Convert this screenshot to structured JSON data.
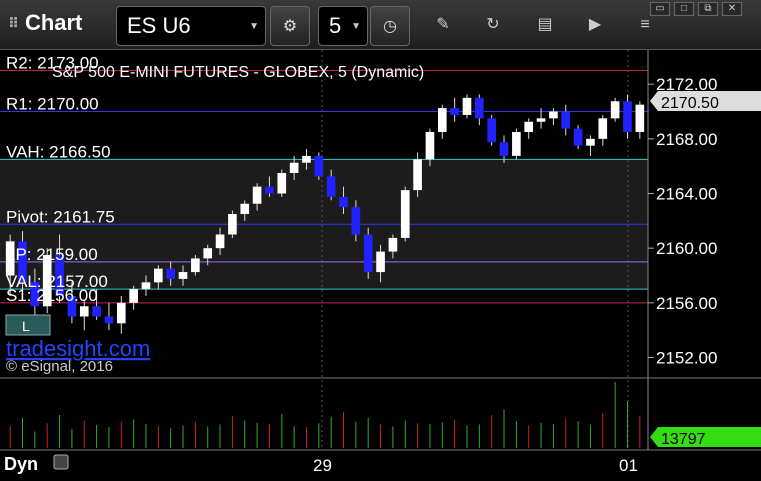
{
  "toolbar": {
    "title": "Chart",
    "symbol": "ES U6",
    "interval": "5"
  },
  "window": {
    "restore": "▭",
    "maximize": "□",
    "close": "✕"
  },
  "chart": {
    "title": "S&P 500 E-MINI FUTURES - GLOBEX, 5 (Dynamic)",
    "watermark": "tradesight.com",
    "copyright": "© eSignal, 2016",
    "price_label": "2170.50",
    "volume_label": "13797",
    "mode_label": "Dyn",
    "y_ticks": [
      "2172.00",
      "2168.00",
      "2164.00",
      "2160.00",
      "2156.00",
      "2152.00"
    ],
    "x_ticks": [
      "29",
      "01"
    ],
    "levels": [
      {
        "name": "R2",
        "label": "R2: 2173.00",
        "value": 2173.0,
        "color": "#cc2222"
      },
      {
        "name": "R1",
        "label": "R1: 2170.00",
        "value": 2170.0,
        "color": "#3333ff"
      },
      {
        "name": "VAH",
        "label": "VAH: 2166.50",
        "value": 2166.5,
        "color": "#33cccc"
      },
      {
        "name": "Pivot",
        "label": "Pivot: 2161.75",
        "value": 2161.75,
        "color": "#3333ff"
      },
      {
        "name": "LP",
        "label": "LP: 2159.00",
        "value": 2159.0,
        "color": "#aa66ff"
      },
      {
        "name": "VAL",
        "label": "VAL: 2157.00",
        "value": 2157.0,
        "color": "#33cccc"
      },
      {
        "name": "S1",
        "label": "S1: 2156.00",
        "value": 2156.0,
        "color": "#cc2255"
      }
    ],
    "badge": "L"
  },
  "chart_data": {
    "type": "bar",
    "title": "S&P 500 E-MINI FUTURES - GLOBEX, 5 (Dynamic)",
    "ylim": [
      2150.5,
      2174.5
    ],
    "candles": [
      [
        2158.0,
        2161.0,
        2156.5,
        2160.5
      ],
      [
        2160.5,
        2161.25,
        2157.0,
        2157.5
      ],
      [
        2157.5,
        2158.5,
        2155.0,
        2155.75
      ],
      [
        2155.75,
        2160.0,
        2155.25,
        2159.5
      ],
      [
        2159.5,
        2161.0,
        2156.0,
        2156.5
      ],
      [
        2156.5,
        2157.5,
        2154.5,
        2155.0
      ],
      [
        2155.0,
        2156.25,
        2154.0,
        2155.75
      ],
      [
        2155.75,
        2157.0,
        2154.75,
        2155.0
      ],
      [
        2155.0,
        2156.0,
        2154.0,
        2154.5
      ],
      [
        2154.5,
        2156.5,
        2153.75,
        2156.0
      ],
      [
        2156.0,
        2157.25,
        2155.5,
        2157.0
      ],
      [
        2157.0,
        2158.0,
        2156.5,
        2157.5
      ],
      [
        2157.5,
        2158.75,
        2157.0,
        2158.5
      ],
      [
        2158.5,
        2159.0,
        2157.25,
        2157.75
      ],
      [
        2157.75,
        2158.75,
        2157.25,
        2158.25
      ],
      [
        2158.25,
        2159.5,
        2158.0,
        2159.25
      ],
      [
        2159.25,
        2160.25,
        2158.75,
        2160.0
      ],
      [
        2160.0,
        2161.5,
        2159.5,
        2161.0
      ],
      [
        2161.0,
        2162.75,
        2160.75,
        2162.5
      ],
      [
        2162.5,
        2163.5,
        2162.0,
        2163.25
      ],
      [
        2163.25,
        2164.75,
        2162.75,
        2164.5
      ],
      [
        2164.5,
        2165.25,
        2163.75,
        2164.0
      ],
      [
        2164.0,
        2165.75,
        2163.75,
        2165.5
      ],
      [
        2165.5,
        2166.75,
        2165.0,
        2166.25
      ],
      [
        2166.25,
        2167.25,
        2165.75,
        2166.75
      ],
      [
        2166.75,
        2167.0,
        2165.0,
        2165.25
      ],
      [
        2165.25,
        2165.75,
        2163.5,
        2163.75
      ],
      [
        2163.75,
        2164.5,
        2162.5,
        2163.0
      ],
      [
        2163.0,
        2163.5,
        2160.5,
        2161.0
      ],
      [
        2161.0,
        2161.5,
        2157.75,
        2158.25
      ],
      [
        2158.25,
        2160.25,
        2157.5,
        2159.75
      ],
      [
        2159.75,
        2161.0,
        2159.25,
        2160.75
      ],
      [
        2160.75,
        2164.5,
        2160.5,
        2164.25
      ],
      [
        2164.25,
        2167.0,
        2163.75,
        2166.5
      ],
      [
        2166.5,
        2168.75,
        2166.0,
        2168.5
      ],
      [
        2168.5,
        2170.5,
        2168.0,
        2170.25
      ],
      [
        2170.25,
        2171.0,
        2169.25,
        2169.75
      ],
      [
        2169.75,
        2171.25,
        2169.5,
        2171.0
      ],
      [
        2171.0,
        2171.25,
        2169.0,
        2169.5
      ],
      [
        2169.5,
        2169.75,
        2167.5,
        2167.75
      ],
      [
        2167.75,
        2168.25,
        2166.25,
        2166.75
      ],
      [
        2166.75,
        2168.75,
        2166.5,
        2168.5
      ],
      [
        2168.5,
        2169.5,
        2168.0,
        2169.25
      ],
      [
        2169.25,
        2170.25,
        2168.75,
        2169.5
      ],
      [
        2169.5,
        2170.25,
        2169.0,
        2170.0
      ],
      [
        2170.0,
        2170.5,
        2168.25,
        2168.75
      ],
      [
        2168.75,
        2169.0,
        2167.25,
        2167.5
      ],
      [
        2167.5,
        2168.25,
        2166.75,
        2168.0
      ],
      [
        2168.0,
        2169.75,
        2167.5,
        2169.5
      ],
      [
        2169.5,
        2171.0,
        2169.25,
        2170.75
      ],
      [
        2170.75,
        2171.25,
        2168.0,
        2168.5
      ],
      [
        2168.5,
        2170.75,
        2168.0,
        2170.5
      ]
    ],
    "volume": [
      40,
      55,
      30,
      45,
      60,
      35,
      50,
      42,
      38,
      48,
      52,
      44,
      40,
      36,
      41,
      47,
      39,
      43,
      58,
      50,
      46,
      44,
      62,
      40,
      38,
      45,
      57,
      66,
      48,
      55,
      42,
      39,
      50,
      45,
      44,
      47,
      52,
      41,
      43,
      60,
      70,
      49,
      41,
      46,
      44,
      53,
      49,
      42,
      64,
      120,
      85,
      58
    ]
  }
}
